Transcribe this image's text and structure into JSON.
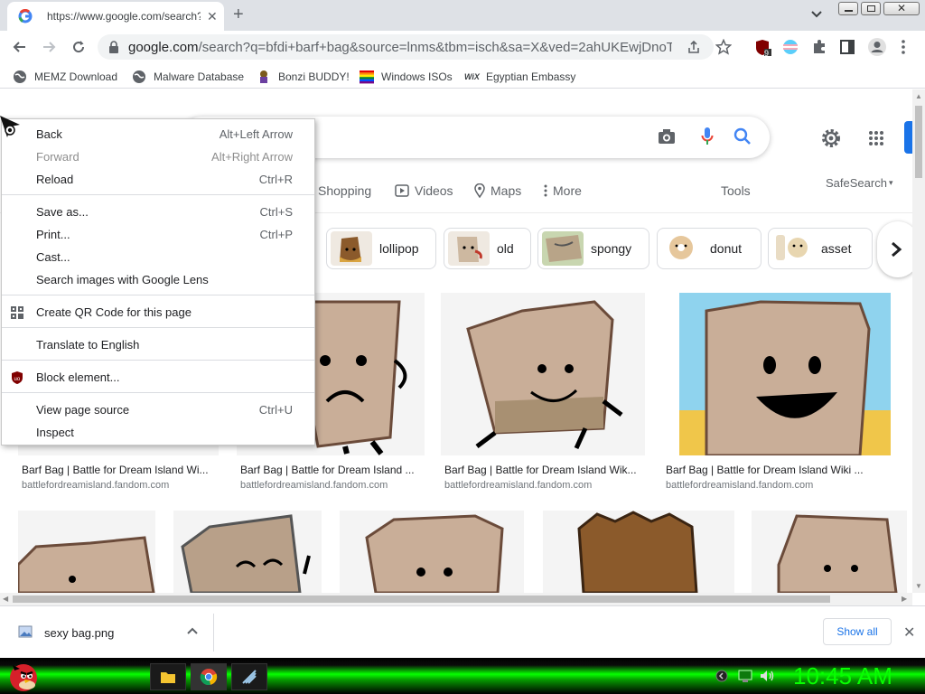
{
  "browser": {
    "tab_title": "https://www.google.com/search?",
    "url_host": "google.com",
    "url_rest": "/search?q=bfdi+barf+bag&source=lnms&tbm=isch&sa=X&ved=2ahUKEwjDnoTEiu...",
    "extension_badge": "9"
  },
  "bookmarks": [
    {
      "label": "MEMZ Download"
    },
    {
      "label": "Malware Database"
    },
    {
      "label": "Bonzi BUDDY!"
    },
    {
      "label": "Windows ISOs"
    },
    {
      "label": "Egyptian Embassy"
    }
  ],
  "search": {
    "tabs": [
      "Shopping",
      "Videos",
      "Maps",
      "More"
    ],
    "tools": "Tools",
    "safesearch": "SafeSearch"
  },
  "chips": [
    "lollipop",
    "old",
    "spongy",
    "donut",
    "asset"
  ],
  "results": [
    {
      "caption": "Barf Bag | Battle for Dream Island Wi...",
      "source": "battlefordreamisland.fandom.com"
    },
    {
      "caption": "Barf Bag | Battle for Dream Island ...",
      "source": "battlefordreamisland.fandom.com"
    },
    {
      "caption": "Barf Bag | Battle for Dream Island Wik...",
      "source": "battlefordreamisland.fandom.com"
    },
    {
      "caption": "Barf Bag | Battle for Dream Island Wiki ...",
      "source": "battlefordreamisland.fandom.com"
    }
  ],
  "context_menu": {
    "back": {
      "label": "Back",
      "shortcut": "Alt+Left Arrow"
    },
    "forward": {
      "label": "Forward",
      "shortcut": "Alt+Right Arrow"
    },
    "reload": {
      "label": "Reload",
      "shortcut": "Ctrl+R"
    },
    "save_as": {
      "label": "Save as...",
      "shortcut": "Ctrl+S"
    },
    "print": {
      "label": "Print...",
      "shortcut": "Ctrl+P"
    },
    "cast": {
      "label": "Cast..."
    },
    "lens": {
      "label": "Search images with Google Lens"
    },
    "qr": {
      "label": "Create QR Code for this page"
    },
    "translate": {
      "label": "Translate to English"
    },
    "block": {
      "label": "Block element..."
    },
    "view_source": {
      "label": "View page source",
      "shortcut": "Ctrl+U"
    },
    "inspect": {
      "label": "Inspect"
    }
  },
  "download": {
    "filename": "sexy bag.png",
    "show_all": "Show all"
  },
  "taskbar": {
    "clock": "10:45 AM"
  },
  "colors": {
    "google_blue": "#4285f4",
    "taskbar_green": "#07ff00",
    "link_blue": "#1a73e8"
  }
}
